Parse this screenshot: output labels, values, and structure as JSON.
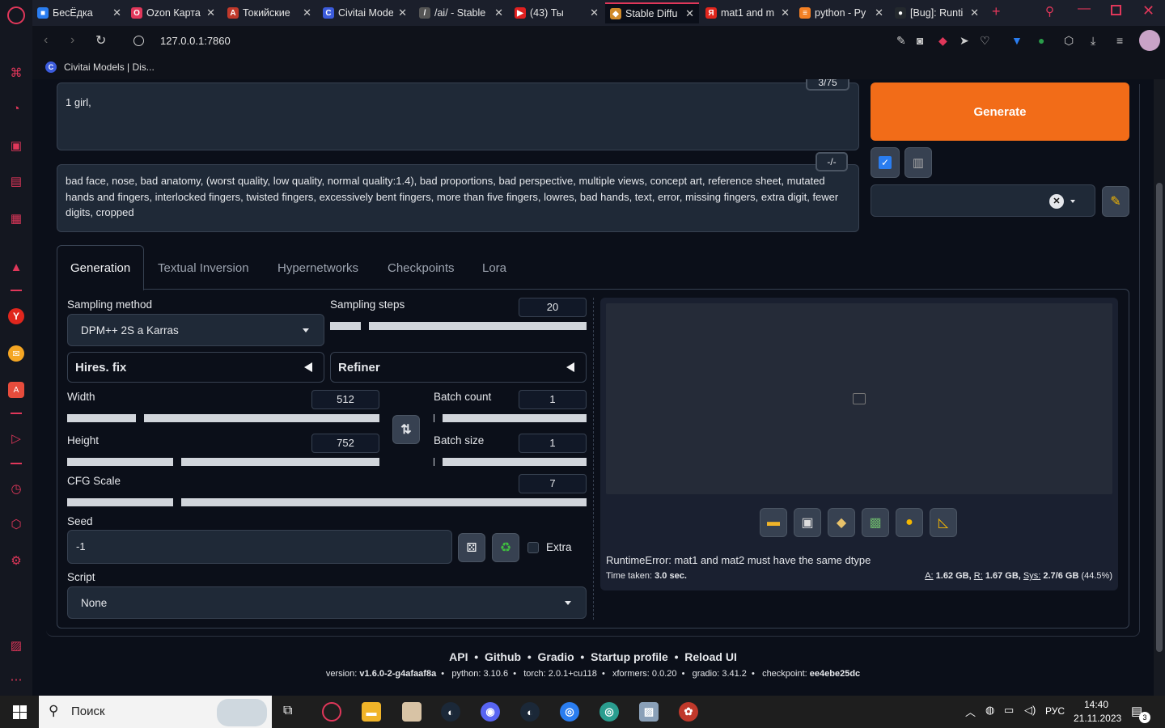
{
  "browser": {
    "tabs": [
      {
        "label": "БесЁдка",
        "color": "#2a7df0",
        "glyph": "■"
      },
      {
        "label": "Ozon Карта",
        "color": "#e0375a",
        "glyph": "O"
      },
      {
        "label": "Токийские",
        "color": "#c0392b",
        "glyph": "A"
      },
      {
        "label": "Civitai Mode",
        "color": "#3b5bdb",
        "glyph": "C"
      },
      {
        "label": "/ai/ - Stable",
        "color": "#555",
        "glyph": "/"
      },
      {
        "label": "(43) Ты",
        "color": "#e02020",
        "glyph": "▶"
      },
      {
        "label": "Stable Diffu",
        "color": "#d08a2a",
        "glyph": "◆"
      },
      {
        "label": "mat1 and m",
        "color": "#e0261d",
        "glyph": "Я"
      },
      {
        "label": "python - Py",
        "color": "#f48024",
        "glyph": "≡"
      },
      {
        "label": "[Bug]: Runti",
        "color": "#24292e",
        "glyph": "●"
      }
    ],
    "url": "127.0.0.1:7860",
    "bookmark": "Civitai Models | Dis..."
  },
  "prompt": {
    "positive": "1 girl,",
    "token_count": "3/75",
    "negative": "bad face, nose, bad anatomy, (worst quality, low quality, normal quality:1.4), bad proportions, bad perspective, multiple views, concept art, reference sheet, mutated hands and fingers, interlocked fingers, twisted fingers, excessively bent fingers, more than five fingers, lowres, bad hands, text, error, missing fingers, extra digit, fewer digits, cropped",
    "neg_badge": "-/-"
  },
  "actions": {
    "generate": "Generate"
  },
  "tabs": [
    "Generation",
    "Textual Inversion",
    "Hypernetworks",
    "Checkpoints",
    "Lora"
  ],
  "params": {
    "sampling_method_label": "Sampling method",
    "sampling_method": "DPM++ 2S a Karras",
    "sampling_steps_label": "Sampling steps",
    "sampling_steps": "20",
    "hires_fix": "Hires. fix",
    "refiner": "Refiner",
    "width_label": "Width",
    "width": "512",
    "height_label": "Height",
    "height": "752",
    "batch_count_label": "Batch count",
    "batch_count": "1",
    "batch_size_label": "Batch size",
    "batch_size": "1",
    "cfg_label": "CFG Scale",
    "cfg": "7",
    "seed_label": "Seed",
    "seed": "-1",
    "extra": "Extra",
    "script_label": "Script",
    "script": "None"
  },
  "output": {
    "error": "RuntimeError: mat1 and mat2 must have the same dtype",
    "time_prefix": "Time taken:",
    "time_value": "3.0 sec.",
    "mem_a_label": "A:",
    "mem_a": "1.62 GB,",
    "mem_r_label": "R:",
    "mem_r": "1.67 GB,",
    "mem_sys_label": "Sys:",
    "mem_sys": "2.7/6 GB",
    "mem_pct": "(44.5%)"
  },
  "footer": {
    "links": [
      "API",
      "Github",
      "Gradio",
      "Startup profile",
      "Reload UI"
    ],
    "version_label": "version:",
    "version": "v1.6.0-2-g4afaaf8a",
    "python_label": "python:",
    "python": "3.10.6",
    "torch_label": "torch:",
    "torch": "2.0.1+cu118",
    "xformers_label": "xformers:",
    "xformers": "0.0.20",
    "gradio_label": "gradio:",
    "gradio": "3.41.2",
    "checkpoint_label": "checkpoint:",
    "checkpoint": "ee4ebe25dc"
  },
  "taskbar": {
    "search_placeholder": "Поиск",
    "lang": "РУС",
    "time": "14:40",
    "date": "21.11.2023",
    "notif_count": "3"
  }
}
